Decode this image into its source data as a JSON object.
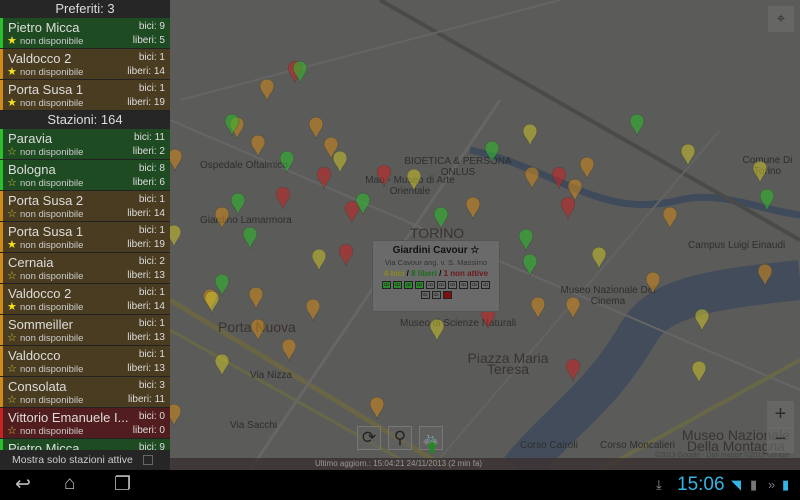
{
  "favorites": {
    "header": "Preferiti: 3",
    "items": [
      {
        "name": "Pietro Micca",
        "status": "non disponibile",
        "bici": "bici: 9",
        "liberi": "liberi: 5",
        "state": "g",
        "fav": true
      },
      {
        "name": "Valdocco 2",
        "status": "non disponibile",
        "bici": "bici: 1",
        "liberi": "liberi: 14",
        "state": "o",
        "fav": true
      },
      {
        "name": "Porta Susa 1",
        "status": "non disponibile",
        "bici": "bici: 1",
        "liberi": "liberi: 19",
        "state": "o",
        "fav": true
      }
    ]
  },
  "stations": {
    "header": "Stazioni: 164",
    "items": [
      {
        "name": "Paravia",
        "status": "non disponibile",
        "bici": "bici: 11",
        "liberi": "liberi: 2",
        "state": "g",
        "fav": false
      },
      {
        "name": "Bologna",
        "status": "non disponibile",
        "bici": "bici: 8",
        "liberi": "liberi: 6",
        "state": "g",
        "fav": false
      },
      {
        "name": "Porta Susa 2",
        "status": "non disponibile",
        "bici": "bici: 1",
        "liberi": "liberi: 14",
        "state": "o",
        "fav": false
      },
      {
        "name": "Porta Susa 1",
        "status": "non disponibile",
        "bici": "bici: 1",
        "liberi": "liberi: 19",
        "state": "o",
        "fav": true
      },
      {
        "name": "Cernaia",
        "status": "non disponibile",
        "bici": "bici: 2",
        "liberi": "liberi: 13",
        "state": "o",
        "fav": false
      },
      {
        "name": "Valdocco 2",
        "status": "non disponibile",
        "bici": "bici: 1",
        "liberi": "liberi: 14",
        "state": "o",
        "fav": true
      },
      {
        "name": "Sommeiller",
        "status": "non disponibile",
        "bici": "bici: 1",
        "liberi": "liberi: 13",
        "state": "o",
        "fav": false
      },
      {
        "name": "Valdocco",
        "status": "non disponibile",
        "bici": "bici: 1",
        "liberi": "liberi: 13",
        "state": "o",
        "fav": false
      },
      {
        "name": "Consolata",
        "status": "non disponibile",
        "bici": "bici: 3",
        "liberi": "liberi: 11",
        "state": "o",
        "fav": false
      },
      {
        "name": "Vittorio Emanuele I...",
        "status": "non disponibile",
        "bici": "bici: 0",
        "liberi": "liberi: 0",
        "state": "r",
        "fav": false
      },
      {
        "name": "Pietro Micca",
        "status": "",
        "bici": "bici: 9",
        "liberi": "",
        "state": "g",
        "fav": true
      }
    ]
  },
  "active_only_label": "Mostra solo stazioni attive",
  "popup": {
    "title": "Giardini Cavour",
    "address": "Via Cavour ang. v. S. Massimo",
    "bici": "4 bici",
    "liberi": "8 liberi",
    "sep": "/",
    "non_attive": "1 non attive",
    "slots": [
      "bike",
      "bike",
      "bike",
      "bike",
      "free",
      "free",
      "free",
      "free",
      "free",
      "free",
      "free",
      "free",
      "broken"
    ]
  },
  "last_update": "Ultimo aggiorn.: 15:04:21 24/11/2013 (2 min fa)",
  "copyright": "©2013 Google - Dati mappe ©2013 Google",
  "map_labels": [
    "Ospedale Oftalmico",
    "BIOETICA & PERSONA ONLUS",
    "Mao - Museo di Arte Orientale",
    "Giardino Lamarmora",
    "TORINO",
    "Porta Nuova",
    "Museo di Scienze Naturali",
    "Piazza Maria Teresa",
    "Museo Nazionale Del Cinema",
    "Campus Luigi Einaudi",
    "Comune Di Torino",
    "Via Nizza",
    "Corso Cairoli",
    "Corso Moncalieri",
    "Museo Nazionale Della Montagna",
    "Via Sacchi"
  ],
  "colors": {
    "green": "#2bbf2b",
    "orange": "#d08a1a",
    "red": "#c82323",
    "yellow": "#c8c22a",
    "accent": "#33b5e5"
  },
  "clock": "15:06"
}
